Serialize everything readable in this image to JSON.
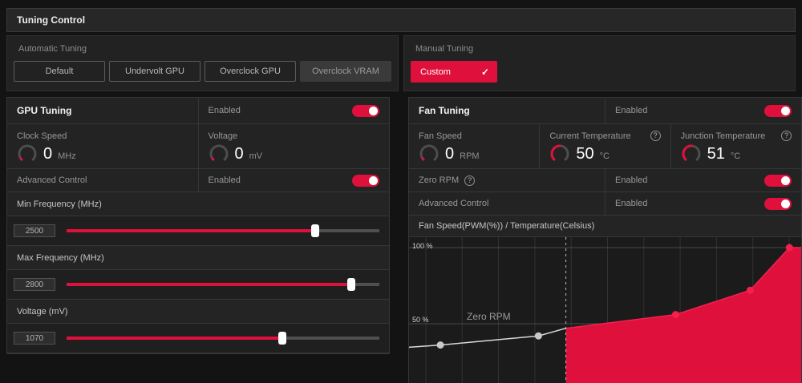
{
  "colors": {
    "accent": "#e0103c",
    "accent_bright": "#f5204f"
  },
  "title_bar": {
    "title": "Tuning Control"
  },
  "automatic_tuning": {
    "label": "Automatic Tuning",
    "buttons": [
      {
        "label": "Default"
      },
      {
        "label": "Undervolt GPU"
      },
      {
        "label": "Overclock GPU"
      },
      {
        "label": "Overclock VRAM"
      }
    ]
  },
  "manual_tuning": {
    "label": "Manual Tuning",
    "custom_button": {
      "label": "Custom",
      "check_icon": "✓"
    }
  },
  "gpu_tuning": {
    "title": "GPU Tuning",
    "enabled_label": "Enabled",
    "clock_speed": {
      "label": "Clock Speed",
      "value": "0",
      "unit": "MHz",
      "gauge_pct": 3
    },
    "voltage": {
      "label": "Voltage",
      "value": "0",
      "unit": "mV",
      "gauge_pct": 3
    },
    "advanced_control": {
      "label": "Advanced Control",
      "enabled_label": "Enabled"
    },
    "sliders": [
      {
        "label": "Min Frequency (MHz)",
        "value": "2500",
        "pct": 79.5
      },
      {
        "label": "Max Frequency (MHz)",
        "value": "2800",
        "pct": 91
      },
      {
        "label": "Voltage (mV)",
        "value": "1070",
        "pct": 69
      }
    ]
  },
  "fan_tuning": {
    "title": "Fan Tuning",
    "enabled_label": "Enabled",
    "fan_speed": {
      "label": "Fan Speed",
      "value": "0",
      "unit": "RPM",
      "gauge_pct": 3
    },
    "current_temperature": {
      "label": "Current Temperature",
      "value": "50",
      "unit": "°C",
      "gauge_pct": 50,
      "help_icon": "?"
    },
    "junction_temperature": {
      "label": "Junction Temperature",
      "value": "51",
      "unit": "°C",
      "gauge_pct": 51,
      "help_icon": "?"
    },
    "zero_rpm": {
      "label": "Zero RPM",
      "help_icon": "?",
      "enabled_label": "Enabled"
    },
    "advanced_control": {
      "label": "Advanced Control",
      "enabled_label": "Enabled"
    },
    "chart_title": "Fan Speed(PWM(%)) / Temperature(Celsius)"
  },
  "chart_data": {
    "type": "area",
    "title": "Fan Speed(PWM(%)) / Temperature(Celsius)",
    "xlabel": "Temperature(Celsius)",
    "ylabel": "Fan Speed(PWM(%))",
    "xlim_pct": [
      0,
      100
    ],
    "ylim": [
      0,
      100
    ],
    "ytick_labels": [
      {
        "value": 100,
        "label": "100 %"
      },
      {
        "value": 50,
        "label": "50 %"
      }
    ],
    "annotation": "Zero RPM",
    "zero_rpm_boundary_x": 40,
    "curve_points": [
      [
        0,
        34.5
      ],
      [
        8,
        36
      ],
      [
        33,
        42
      ],
      [
        40,
        47
      ],
      [
        68,
        56
      ],
      [
        87,
        72
      ],
      [
        97,
        100
      ],
      [
        100,
        100
      ]
    ],
    "zero_rpm_segment": [
      [
        0,
        34.5
      ],
      [
        8,
        36
      ],
      [
        33,
        42
      ],
      [
        40,
        47
      ]
    ],
    "active_segment": [
      [
        40,
        47
      ],
      [
        68,
        56
      ],
      [
        87,
        72
      ],
      [
        97,
        100
      ],
      [
        100,
        100
      ]
    ],
    "zero_rpm_dots": [
      [
        8,
        36
      ],
      [
        33,
        42
      ]
    ],
    "active_dots": [
      [
        68,
        56
      ],
      [
        87,
        72
      ],
      [
        97,
        100
      ]
    ],
    "grid": true,
    "legend": false
  }
}
